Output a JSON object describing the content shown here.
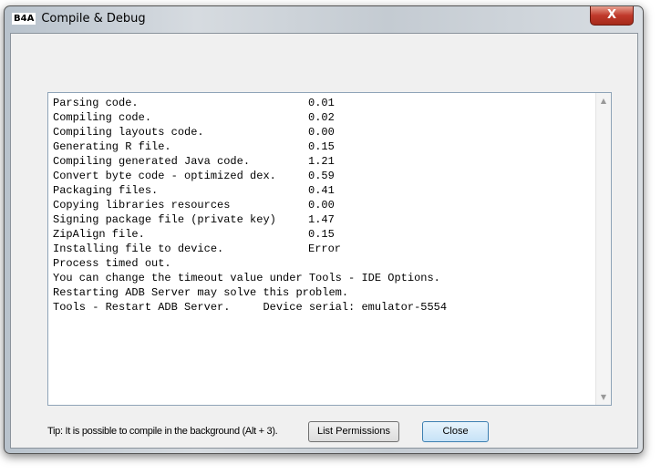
{
  "window": {
    "title": "Compile & Debug",
    "logo": "B4A",
    "close_glyph": "X"
  },
  "log": [
    [
      "Parsing code.",
      "0.01"
    ],
    [
      "Compiling code.",
      "0.02"
    ],
    [
      "Compiling layouts code.",
      "0.00"
    ],
    [
      "Generating R file.",
      "0.15"
    ],
    [
      "Compiling generated Java code.",
      "1.21"
    ],
    [
      "Convert byte code - optimized dex.",
      "0.59"
    ],
    [
      "Packaging files.",
      "0.41"
    ],
    [
      "Copying libraries resources",
      "0.00"
    ],
    [
      "Signing package file (private key)",
      "1.47"
    ],
    [
      "ZipAlign file.",
      "0.15"
    ],
    [
      "Installing file to device.",
      "Error"
    ],
    [
      "Process timed out.",
      ""
    ],
    [
      "You can change the timeout value under Tools - IDE Options.",
      ""
    ],
    [
      "Restarting ADB Server may solve this problem.",
      ""
    ],
    [
      "Tools - Restart ADB Server.     Device serial: emulator-5554",
      ""
    ]
  ],
  "tip": "Tip: It is possible to compile in the background (Alt + 3).",
  "buttons": {
    "list_permissions": "List Permissions",
    "close": "Close"
  }
}
